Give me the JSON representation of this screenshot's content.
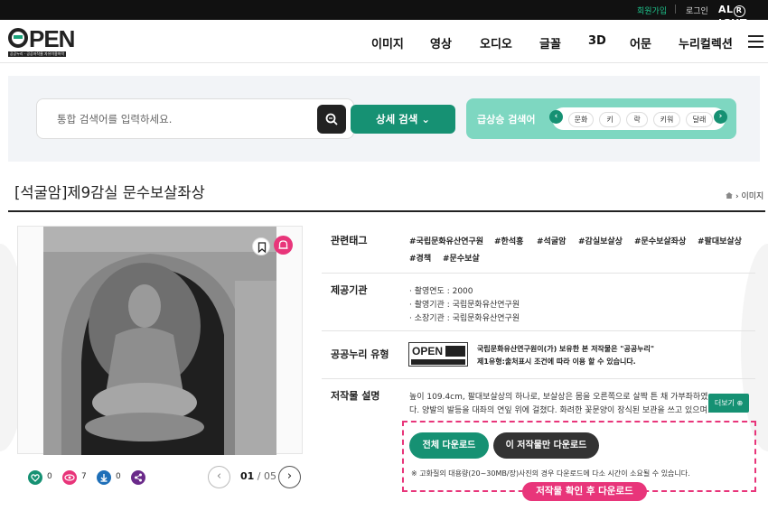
{
  "topbar": {
    "join": "회원가입",
    "login": "로그인",
    "brand_pre": "AL",
    "brand_r": "R",
    "brand_post": "IGHT"
  },
  "header": {
    "logo_text": "PEN",
    "logo_sub": "공공누리 · 공공저작물 자유이용허락",
    "nav": [
      "이미지",
      "영상",
      "오디오",
      "글꼴",
      "3D",
      "어문",
      "누리컬렉션"
    ]
  },
  "search": {
    "placeholder": "통합 검색어를 입력하세요.",
    "detail_label": "상세 검색",
    "trend_label": "급상승 검색어",
    "trend_terms": [
      "문화",
      "키",
      "락",
      "키워",
      "달래"
    ]
  },
  "page": {
    "title": "[석굴암]제9감실 문수보살좌상",
    "breadcrumb": "이미지"
  },
  "stats": {
    "likes": "0",
    "views": "7",
    "downloads": "0"
  },
  "pager": {
    "current": "01",
    "sep": " / ",
    "total": "05"
  },
  "info": {
    "tags_label": "관련태그",
    "tags_line1": [
      "#국립문화유산연구원",
      "#한석홍",
      "#석굴암",
      "#감실보살상",
      "#문수보살좌상",
      "#팔대보살상"
    ],
    "tags_line2": [
      "#경책",
      "#문수보살"
    ],
    "provider_label": "제공기관",
    "provider_lines": [
      "· 촬영연도 : 2000",
      "· 촬영기관 : 국립문화유산연구원",
      "· 소장기관 : 국립문화유산연구원"
    ],
    "license_label": "공공누리 유형",
    "license_badge": "OPEN",
    "license_lines": [
      "국립문화유산연구원이(가) 보유한 본 저작물은 \"공공누리\"",
      "제1유형:출처표시 조건에 따라 이용 할 수 있습니다."
    ],
    "desc_label": "저작물 설명",
    "desc_lines": [
      "높이 109.4cm, 팔대보살상의 하나로, 보살상은 몸을 오른쪽으로 살짝 튼 채 가부좌하였",
      "다. 양발의 발등을 대좌의 연잎 위에 걸쳤다. 화려한 꽃문양이 장식된 보관을 쓰고 있으며…"
    ],
    "more_label": "더보기 ⊕"
  },
  "download": {
    "all_label": "전체 다운로드",
    "this_label": "이 저작물만 다운로드",
    "note": "※ 고화질의 대용량(20~30MB/장)사진의 경우 다운로드에 다소 시간이 소요될 수 있습니다.",
    "badge": "저작물 확인 후 다운로드"
  },
  "colors": {
    "primary": "#169173",
    "accent": "#e8357a",
    "trend_bg": "#7ed7c1"
  }
}
